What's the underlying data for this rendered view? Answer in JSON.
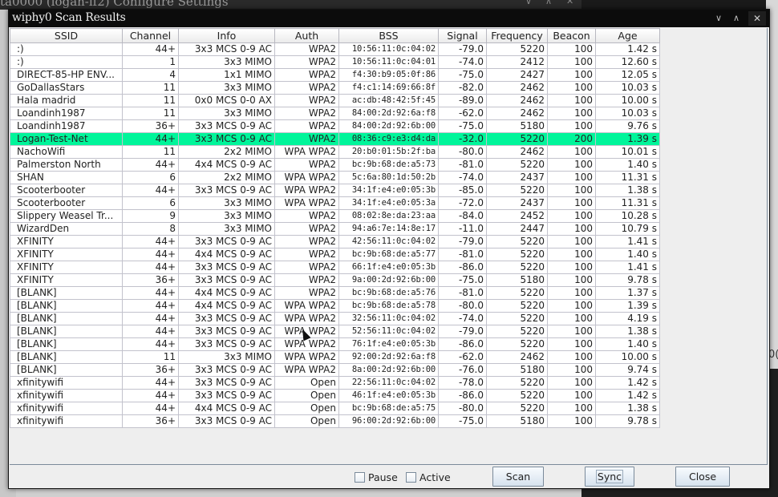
{
  "background_window": {
    "title": "ta0000  (logan-if2) Configure Settings",
    "side_text": "0("
  },
  "dialog": {
    "title": "wiphy0 Scan Results",
    "controls": {
      "minimize": "∨",
      "maximize": "∧",
      "close": "✕"
    }
  },
  "table": {
    "columns": [
      "SSID",
      "Channel",
      "Info",
      "Auth",
      "BSS",
      "Signal",
      "Frequency",
      "Beacon",
      "Age"
    ],
    "selected_row_index": 7,
    "selected_color": "#00f59a",
    "rows": [
      [
        ":)",
        "44+",
        "3x3 MCS 0-9 AC",
        "WPA2",
        "10:56:11:0c:04:02",
        "-79.0",
        "5220",
        "100",
        "1.42 s"
      ],
      [
        ":)",
        "1",
        "3x3 MIMO",
        "WPA2",
        "10:56:11:0c:04:01",
        "-74.0",
        "2412",
        "100",
        "12.60 s"
      ],
      [
        "DIRECT-85-HP ENV...",
        "4",
        "1x1 MIMO",
        "WPA2",
        "f4:30:b9:05:0f:86",
        "-75.0",
        "2427",
        "100",
        "12.05 s"
      ],
      [
        "GoDallasStars",
        "11",
        "3x3 MIMO",
        "WPA2",
        "f4:c1:14:69:66:8f",
        "-82.0",
        "2462",
        "100",
        "10.03 s"
      ],
      [
        "Hala madrid",
        "11",
        "0x0 MCS 0-0 AX",
        "WPA2",
        "ac:db:48:42:5f:45",
        "-89.0",
        "2462",
        "100",
        "10.00 s"
      ],
      [
        "Loandinh1987",
        "11",
        "3x3 MIMO",
        "WPA2",
        "84:00:2d:92:6a:f8",
        "-62.0",
        "2462",
        "100",
        "10.03 s"
      ],
      [
        "Loandinh1987",
        "36+",
        "3x3 MCS 0-9 AC",
        "WPA2",
        "84:00:2d:92:6b:00",
        "-75.0",
        "5180",
        "100",
        "9.76 s"
      ],
      [
        "Logan-Test-Net",
        "44+",
        "3x3 MCS 0-9 AC",
        "WPA2",
        "08:36:c9:e3:d4:da",
        "-32.0",
        "5220",
        "200",
        "1.39 s"
      ],
      [
        "NachoWifi",
        "11",
        "2x2 MIMO",
        "WPA WPA2",
        "20:b0:01:5b:2f:ba",
        "-80.0",
        "2462",
        "100",
        "10.01 s"
      ],
      [
        "Palmerston North",
        "44+",
        "4x4 MCS 0-9 AC",
        "WPA2",
        "bc:9b:68:de:a5:73",
        "-81.0",
        "5220",
        "100",
        "1.40 s"
      ],
      [
        "SHAN",
        "6",
        "2x2 MIMO",
        "WPA WPA2",
        "5c:6a:80:1d:50:2b",
        "-74.0",
        "2437",
        "100",
        "11.31 s"
      ],
      [
        "Scooterbooter",
        "44+",
        "3x3 MCS 0-9 AC",
        "WPA WPA2",
        "34:1f:e4:e0:05:3b",
        "-85.0",
        "5220",
        "100",
        "1.38 s"
      ],
      [
        "Scooterbooter",
        "6",
        "3x3 MIMO",
        "WPA WPA2",
        "34:1f:e4:e0:05:3a",
        "-72.0",
        "2437",
        "100",
        "11.31 s"
      ],
      [
        "Slippery Weasel Tr...",
        "9",
        "3x3 MIMO",
        "WPA2",
        "08:02:8e:da:23:aa",
        "-84.0",
        "2452",
        "100",
        "10.28 s"
      ],
      [
        "WizardDen",
        "8",
        "3x3 MIMO",
        "WPA2",
        "94:a6:7e:14:8e:17",
        "-11.0",
        "2447",
        "100",
        "10.79 s"
      ],
      [
        "XFINITY",
        "44+",
        "3x3 MCS 0-9 AC",
        "WPA2",
        "42:56:11:0c:04:02",
        "-79.0",
        "5220",
        "100",
        "1.41 s"
      ],
      [
        "XFINITY",
        "44+",
        "4x4 MCS 0-9 AC",
        "WPA2",
        "bc:9b:68:de:a5:77",
        "-81.0",
        "5220",
        "100",
        "1.40 s"
      ],
      [
        "XFINITY",
        "44+",
        "3x3 MCS 0-9 AC",
        "WPA2",
        "66:1f:e4:e0:05:3b",
        "-86.0",
        "5220",
        "100",
        "1.41 s"
      ],
      [
        "XFINITY",
        "36+",
        "3x3 MCS 0-9 AC",
        "WPA2",
        "9a:00:2d:92:6b:00",
        "-75.0",
        "5180",
        "100",
        "9.78 s"
      ],
      [
        "[BLANK]",
        "44+",
        "4x4 MCS 0-9 AC",
        "WPA2",
        "bc:9b:68:de:a5:76",
        "-81.0",
        "5220",
        "100",
        "1.37 s"
      ],
      [
        "[BLANK]",
        "44+",
        "4x4 MCS 0-9 AC",
        "WPA WPA2",
        "bc:9b:68:de:a5:78",
        "-80.0",
        "5220",
        "100",
        "1.39 s"
      ],
      [
        "[BLANK]",
        "44+",
        "3x3 MCS 0-9 AC",
        "WPA WPA2",
        "32:56:11:0c:04:02",
        "-74.0",
        "5220",
        "100",
        "4.19 s"
      ],
      [
        "[BLANK]",
        "44+",
        "3x3 MCS 0-9 AC",
        "WPA WPA2",
        "52:56:11:0c:04:02",
        "-79.0",
        "5220",
        "100",
        "1.38 s"
      ],
      [
        "[BLANK]",
        "44+",
        "3x3 MCS 0-9 AC",
        "WPA WPA2",
        "76:1f:e4:e0:05:3b",
        "-86.0",
        "5220",
        "100",
        "1.40 s"
      ],
      [
        "[BLANK]",
        "11",
        "3x3 MIMO",
        "WPA WPA2",
        "92:00:2d:92:6a:f8",
        "-62.0",
        "2462",
        "100",
        "10.00 s"
      ],
      [
        "[BLANK]",
        "36+",
        "3x3 MCS 0-9 AC",
        "WPA WPA2",
        "8a:00:2d:92:6b:00",
        "-76.0",
        "5180",
        "100",
        "9.74 s"
      ],
      [
        "xfinitywifi",
        "44+",
        "3x3 MCS 0-9 AC",
        "Open",
        "22:56:11:0c:04:02",
        "-78.0",
        "5220",
        "100",
        "1.42 s"
      ],
      [
        "xfinitywifi",
        "44+",
        "3x3 MCS 0-9 AC",
        "Open",
        "46:1f:e4:e0:05:3b",
        "-86.0",
        "5220",
        "100",
        "1.42 s"
      ],
      [
        "xfinitywifi",
        "44+",
        "4x4 MCS 0-9 AC",
        "Open",
        "bc:9b:68:de:a5:75",
        "-80.0",
        "5220",
        "100",
        "1.38 s"
      ],
      [
        "xfinitywifi",
        "36+",
        "3x3 MCS 0-9 AC",
        "Open",
        "96:00:2d:92:6b:00",
        "-75.0",
        "5180",
        "100",
        "9.78 s"
      ]
    ]
  },
  "footer": {
    "pause_label": "Pause",
    "pause_checked": false,
    "active_label": "Active",
    "active_checked": false,
    "scan_label": "Scan",
    "sync_label": "Sync",
    "close_label": "Close"
  }
}
